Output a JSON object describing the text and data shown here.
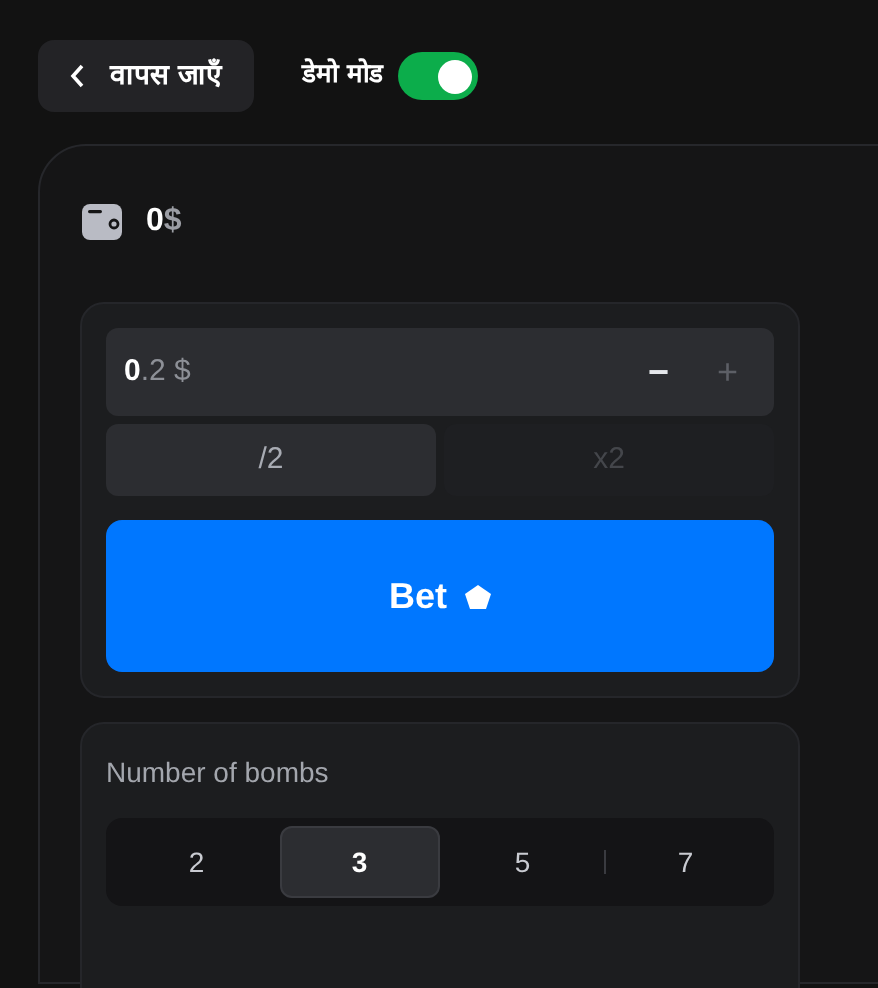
{
  "header": {
    "back_button": "वापस जाएँ",
    "demo_mode": {
      "label": "डेमो मोड",
      "on": true
    }
  },
  "balance": {
    "amount": "0",
    "currency": "$"
  },
  "bet": {
    "amount": "**0**.2 $",
    "minus": {
      "label": "−",
      "disabled": false
    },
    "plus": {
      "label": "+",
      "disabled": true
    },
    "halve": {
      "label": "/2",
      "disabled": false
    },
    "double": {
      "label": "x2",
      "disabled": true
    },
    "button": "Bet"
  },
  "bombs": {
    "label": "Number of bombs",
    "options": [
      {
        "label": "2",
        "selected": false
      },
      {
        "label": "3",
        "selected": true
      },
      {
        "label": "5",
        "selected": false
      },
      {
        "label": "7",
        "selected": false
      }
    ]
  }
}
